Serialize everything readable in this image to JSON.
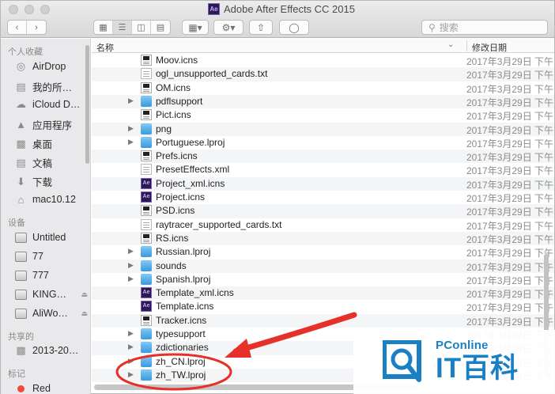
{
  "window": {
    "title": "Adobe After Effects CC 2015",
    "app_badge": "Ae"
  },
  "toolbar": {
    "back_icon": "chevron-left-icon",
    "forward_icon": "chevron-right-icon",
    "search_placeholder": "搜索"
  },
  "sidebar": {
    "favorites_header": "个人收藏",
    "favorites": [
      {
        "label": "AirDrop",
        "icon": "airdrop-icon"
      },
      {
        "label": "我的所…",
        "icon": "all-files-icon"
      },
      {
        "label": "iCloud D…",
        "icon": "cloud-icon"
      },
      {
        "label": "应用程序",
        "icon": "applications-icon"
      },
      {
        "label": "桌面",
        "icon": "desktop-icon"
      },
      {
        "label": "文稿",
        "icon": "document-icon"
      },
      {
        "label": "下载",
        "icon": "download-icon"
      },
      {
        "label": "mac10.12",
        "icon": "home-icon"
      }
    ],
    "devices_header": "设备",
    "devices": [
      {
        "label": "Untitled"
      },
      {
        "label": "77"
      },
      {
        "label": "777"
      },
      {
        "label": "KING…",
        "eject": true
      },
      {
        "label": "AliWo…",
        "eject": true
      }
    ],
    "shared_header": "共享的",
    "shared": [
      {
        "label": "2013-20…"
      }
    ],
    "tags_header": "标记",
    "tags": [
      {
        "label": "Red",
        "color": "#f04a3e"
      }
    ]
  },
  "list": {
    "col_name": "名称",
    "col_date": "修改日期",
    "date_text": "2017年3月29日 下午",
    "rows": [
      {
        "name": "Moov.icns",
        "type": "icns"
      },
      {
        "name": "ogl_unsupported_cards.txt",
        "type": "doc"
      },
      {
        "name": "OM.icns",
        "type": "icns"
      },
      {
        "name": "pdflsupport",
        "type": "folder"
      },
      {
        "name": "Pict.icns",
        "type": "icns"
      },
      {
        "name": "png",
        "type": "folder"
      },
      {
        "name": "Portuguese.lproj",
        "type": "folder"
      },
      {
        "name": "Prefs.icns",
        "type": "icns"
      },
      {
        "name": "PresetEffects.xml",
        "type": "doc"
      },
      {
        "name": "Project_xml.icns",
        "type": "ae"
      },
      {
        "name": "Project.icns",
        "type": "ae"
      },
      {
        "name": "PSD.icns",
        "type": "icns"
      },
      {
        "name": "raytracer_supported_cards.txt",
        "type": "doc"
      },
      {
        "name": "RS.icns",
        "type": "icns"
      },
      {
        "name": "Russian.lproj",
        "type": "folder"
      },
      {
        "name": "sounds",
        "type": "folder"
      },
      {
        "name": "Spanish.lproj",
        "type": "folder"
      },
      {
        "name": "Template_xml.icns",
        "type": "ae"
      },
      {
        "name": "Template.icns",
        "type": "ae"
      },
      {
        "name": "Tracker.icns",
        "type": "icns"
      },
      {
        "name": "typesupport",
        "type": "folder"
      },
      {
        "name": "zdictionaries",
        "type": "folder"
      },
      {
        "name": "zh_CN.lproj",
        "type": "folder"
      },
      {
        "name": "zh_TW.lproj",
        "type": "folder"
      }
    ]
  },
  "watermark": {
    "brand": "PConline",
    "logo_text": "IT百科",
    "brand_color": "#1b7fc4"
  },
  "annotation": {
    "color": "#e8302a"
  }
}
